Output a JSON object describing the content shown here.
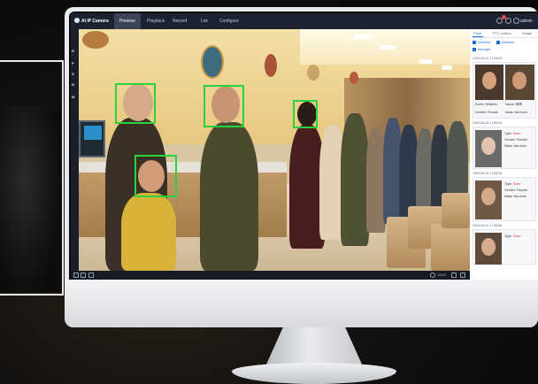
{
  "app": {
    "title": "AI IP Camera"
  },
  "nav_tabs": [
    {
      "label": "Preview",
      "active": true
    },
    {
      "label": "Playback",
      "active": false
    },
    {
      "label": "Record",
      "active": false
    },
    {
      "label": "List",
      "active": false
    },
    {
      "label": "Configure",
      "active": false
    }
  ],
  "topbar": {
    "user": "admin",
    "notification_count": "1",
    "icons": [
      "bell-icon",
      "help-icon",
      "user-icon"
    ]
  },
  "left_nav": [
    "R",
    "P",
    "S",
    "N",
    "M"
  ],
  "right_panel": {
    "tabs": [
      {
        "label": "Push",
        "active": true
      },
      {
        "label": "PTZ control",
        "active": false
      },
      {
        "label": "Image",
        "active": false
      }
    ],
    "filters": [
      {
        "label": "whitelist",
        "checked": true
      },
      {
        "label": "blacklist",
        "checked": true
      },
      {
        "label": "stranger",
        "checked": true
      }
    ],
    "events": [
      {
        "time": "2025-06-24 17:56:53",
        "type_label": "",
        "type_value": "",
        "gender_label": "",
        "gender_value": "",
        "mask_label": "",
        "mask_value": ""
      },
      {
        "time": "2025-06-24 17:56:53",
        "type_label": "Type:",
        "type_value": "Stare",
        "gender_label": "Gender:",
        "gender_value": "Female",
        "mask_label": "Mask:",
        "mask_value": "Not worn"
      },
      {
        "time": "2025-06-24 17:56:56",
        "type_label": "Type:",
        "type_value": "Stare",
        "gender_label": "Gender:",
        "gender_value": "Female",
        "mask_label": "Mask:",
        "mask_value": "Not worn"
      },
      {
        "time": "2025-06-24 17:56:56",
        "type_label": "Type:",
        "type_value": "Stare",
        "gender_label": "",
        "gender_value": "",
        "mask_label": "",
        "mask_value": ""
      }
    ],
    "first_card": {
      "event_label": "Event:",
      "event_value": "Whitelist",
      "name_label": "Name:",
      "name_value": "朱晴",
      "gender_label": "Gender:",
      "gender_value": "Female",
      "mask_label": "Mask:",
      "mask_value": "Not worn"
    }
  },
  "bottombar": {
    "zoom": "100%"
  },
  "colors": {
    "detection_box": "#28d33d",
    "accent": "#1e6fd9",
    "topbar": "#1d2230"
  }
}
